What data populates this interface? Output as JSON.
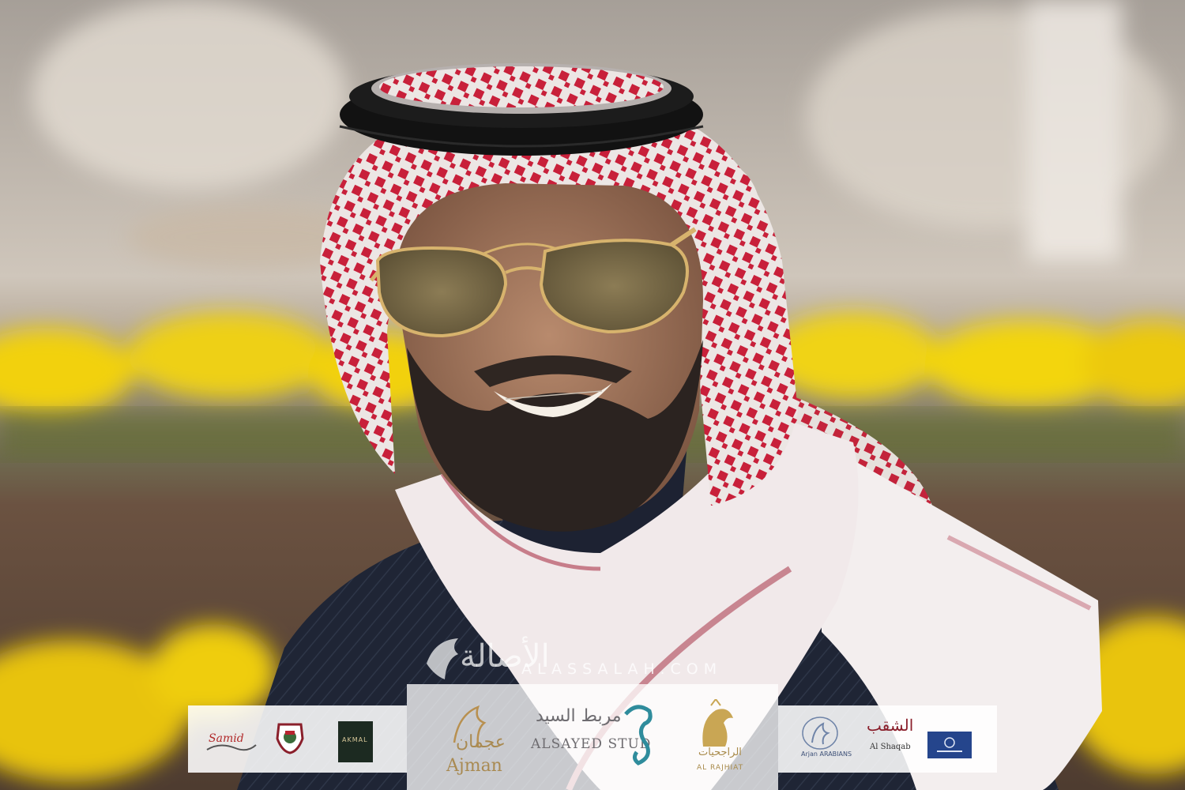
{
  "watermark": {
    "site": "ALASSALAH.COM",
    "logo_text": "الأصالة"
  },
  "sponsors": {
    "left": [
      {
        "name": "Samid",
        "arabic": ""
      },
      {
        "name": "",
        "arabic": ""
      },
      {
        "name": "AKMAL",
        "arabic": ""
      }
    ],
    "center": [
      {
        "name": "Ajman",
        "arabic": "عجمان"
      },
      {
        "name": "ALSAYED STUD",
        "arabic": "مربط السيد"
      },
      {
        "name": "AL RAJHIAT",
        "arabic": "الراجحيات"
      }
    ],
    "right": [
      {
        "name": "Arjan ARABIANS",
        "arabic": ""
      },
      {
        "name": "Al Shaqab",
        "arabic": "الشقب"
      },
      {
        "name": "",
        "arabic": ""
      }
    ]
  },
  "colors": {
    "sky": "#b9afa5",
    "flowers": "#f2d10a",
    "ghutra_red": "#c8203a",
    "thobe_navy": "#1e2434",
    "wm_gold": "#c9a654",
    "wm_teal": "#2f8c9c"
  }
}
